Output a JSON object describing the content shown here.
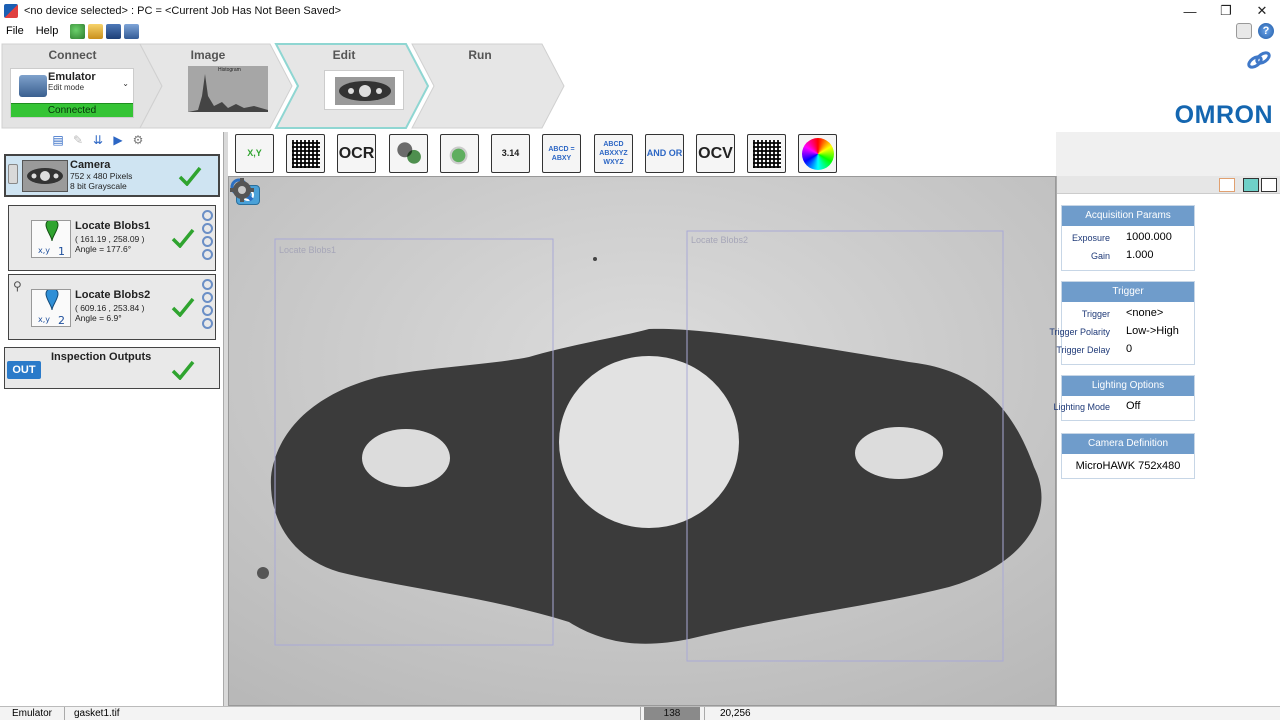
{
  "window": {
    "title": "<no device selected>  :  PC =  <Current Job Has Not Been Saved>",
    "minimize": "—",
    "maximize": "❐",
    "close": "✕"
  },
  "menu": {
    "file": "File",
    "help": "Help"
  },
  "workflow": {
    "steps": [
      {
        "label": "Connect"
      },
      {
        "label": "Image"
      },
      {
        "label": "Edit"
      },
      {
        "label": "Run"
      }
    ],
    "device": {
      "name": "Emulator",
      "mode": "Edit mode",
      "status": "Connected"
    },
    "image_thumb_label": "Histogram"
  },
  "brand": {
    "name": "OMRON",
    "color": "#1466b0"
  },
  "tools": {
    "camera": {
      "title": "Camera",
      "resolution": "752 x 480 Pixels",
      "depth": "8 bit Grayscale"
    },
    "blobs": [
      {
        "title": "Locate Blobs1",
        "coords": "( 161.19 , 258.09 )",
        "angle": "Angle = 177.6°",
        "index": "1"
      },
      {
        "title": "Locate Blobs2",
        "coords": "( 609.16 , 253.84 )",
        "angle": "Angle = 6.9°",
        "index": "2"
      }
    ],
    "outputs": {
      "title": "Inspection Outputs",
      "badge": "OUT"
    }
  },
  "palette": [
    {
      "name": "locate-tool",
      "icon": "pin-icon",
      "label": "X,Y"
    },
    {
      "name": "datamatrix-tool",
      "icon": "datamatrix-icon",
      "label": ""
    },
    {
      "name": "ocr-tool",
      "icon": "ocr-icon",
      "label": "OCR"
    },
    {
      "name": "blob-count-tool",
      "icon": "blobs-icon",
      "label": ""
    },
    {
      "name": "presence-tool",
      "icon": "presence-icon",
      "label": ""
    },
    {
      "name": "measure-tool",
      "icon": "ruler-icon",
      "label": "3.14"
    },
    {
      "name": "text-match-tool",
      "icon": "text-match-icon",
      "label": "ABCD = ABXY"
    },
    {
      "name": "text-verify-tool",
      "icon": "text-verify-icon",
      "label": "ABCD ABXXYZ WXYZ"
    },
    {
      "name": "logic-tool",
      "icon": "logic-icon",
      "label": "AND OR"
    },
    {
      "name": "ocv-tool",
      "icon": "ocv-icon",
      "label": "OCV"
    },
    {
      "name": "verify-code-tool",
      "icon": "verify-code-icon",
      "label": ""
    },
    {
      "name": "color-tool",
      "icon": "color-wheel-icon",
      "label": ""
    }
  ],
  "image": {
    "roi_labels": [
      "Locate Blobs1",
      "Locate Blobs2"
    ]
  },
  "params": {
    "acquisition": {
      "title": "Acquisition Params",
      "exposure_key": "Exposure",
      "exposure": "1000.000",
      "gain_key": "Gain",
      "gain": "1.000"
    },
    "trigger": {
      "title": "Trigger",
      "trigger_key": "Trigger",
      "trigger": "<none>",
      "polarity_key": "Trigger Polarity",
      "polarity": "Low->High",
      "delay_key": "Trigger Delay",
      "delay": "0"
    },
    "lighting": {
      "title": "Lighting Options",
      "mode_key": "Lighting Mode",
      "mode": "Off"
    },
    "camera_def": {
      "title": "Camera Definition",
      "model": "MicroHAWK 752x480"
    }
  },
  "status": {
    "device": "Emulator",
    "file": "gasket1.tif",
    "pixel_value": "138",
    "coords": "20,256"
  },
  "colors": {
    "accent": "#6f9ccb",
    "connected": "#35c435",
    "roi": "#a9a9d6"
  }
}
